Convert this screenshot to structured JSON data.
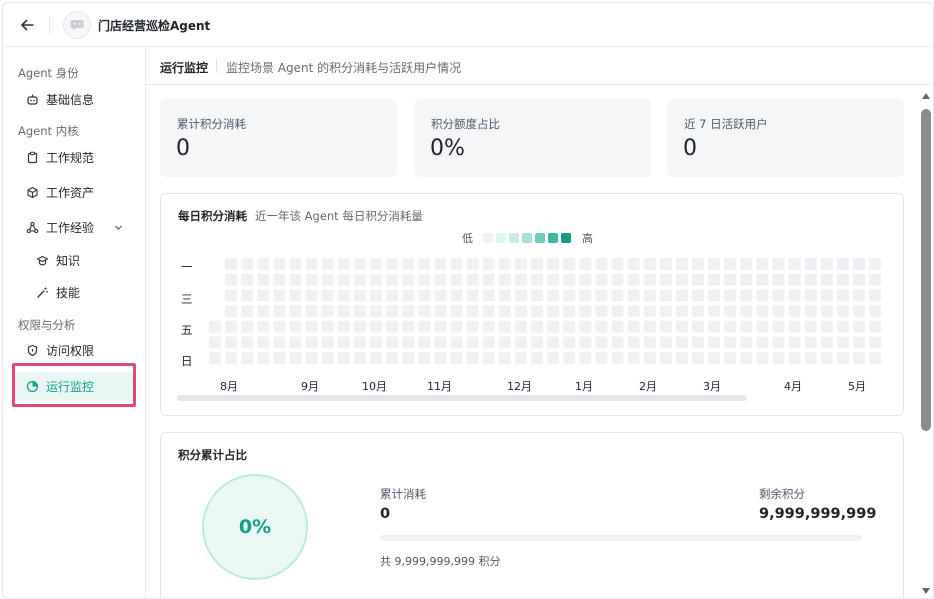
{
  "header": {
    "title": "门店经营巡检Agent",
    "back_icon": "arrow-left-icon",
    "avatar_icon": "chat-bubble-icon"
  },
  "sidebar": {
    "groups": [
      {
        "label": "Agent 身份"
      },
      {
        "label": "Agent 内核"
      },
      {
        "label": "权限与分析"
      }
    ],
    "items": [
      {
        "label": "基础信息",
        "icon": "robot-icon"
      },
      {
        "label": "工作规范",
        "icon": "clipboard-icon"
      },
      {
        "label": "工作资产",
        "icon": "cube-icon"
      },
      {
        "label": "工作经验",
        "icon": "network-icon",
        "expanded": true
      },
      {
        "label": "知识",
        "icon": "book-icon"
      },
      {
        "label": "技能",
        "icon": "magic-wand-icon"
      },
      {
        "label": "访问权限",
        "icon": "shield-icon"
      },
      {
        "label": "运行监控",
        "icon": "monitor-icon",
        "active": true
      }
    ],
    "accent": "#15a18c",
    "highlight_color": "#e0467f"
  },
  "main": {
    "title": "运行监控",
    "description": "监控场景 Agent 的积分消耗与活跃用户情况",
    "stats": [
      {
        "label": "累计积分消耗",
        "value": "0"
      },
      {
        "label": "积分额度占比",
        "value": "0%"
      },
      {
        "label": "近 7 日活跃用户",
        "value": "0"
      }
    ],
    "daily": {
      "title": "每日积分消耗",
      "description": "近一年该 Agent 每日积分消耗量",
      "legend_low": "低",
      "legend_high": "高",
      "legend_colors": [
        "#eef1f4",
        "#dff5f1",
        "#c6ece6",
        "#a4e0d6",
        "#72cbbd",
        "#3cb6a3",
        "#129c88"
      ],
      "day_labels": [
        "一",
        "三",
        "五",
        "日"
      ],
      "months": [
        "8月",
        "9月",
        "10月",
        "11月",
        "12月",
        "1月",
        "2月",
        "3月",
        "4月",
        "5月"
      ],
      "empty_color": "#eef0f3"
    },
    "cumulative": {
      "title": "积分累计占比",
      "percent": "0%",
      "consumed_label": "累计消耗",
      "consumed_value": "0",
      "remaining_label": "剩余积分",
      "remaining_value": "9,999,999,999",
      "progress": 0,
      "total_text": "共 9,999,999,999 积分"
    }
  }
}
